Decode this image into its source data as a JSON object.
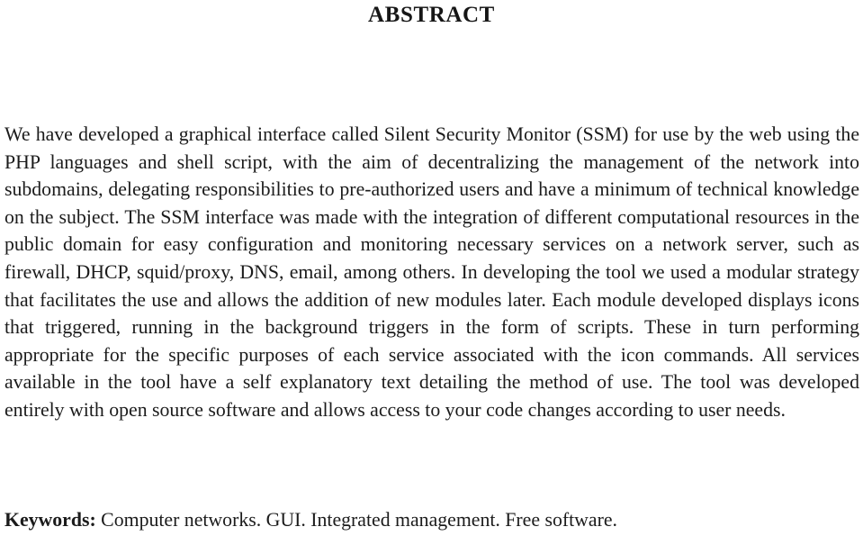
{
  "document": {
    "section_title": "ABSTRACT",
    "abstract_paragraph": "We have developed a graphical interface called Silent Security Monitor (SSM) for use by the web using the PHP languages and shell script, with the aim of decentralizing the management of the network into subdomains, delegating responsibilities to pre-authorized users and have a minimum of technical knowledge on the subject. The SSM interface was made with the integration of different computational resources in the public domain for easy configuration and monitoring necessary services on a network server, such as firewall, DHCP, squid/proxy, DNS, email, among others. In developing the tool we used a modular strategy that facilitates the use and allows the addition of new modules later. Each module developed displays icons that triggered, running in the background triggers in the form of scripts. These in turn performing appropriate for the specific purposes of each service associated with the icon commands. All services available in the tool have a self explanatory text detailing the method of use. The tool was developed entirely with open source software and allows access to your code changes according to user needs.",
    "keywords": {
      "label": "Keywords:",
      "values": "Computer networks. GUI. Integrated management. Free software."
    }
  }
}
